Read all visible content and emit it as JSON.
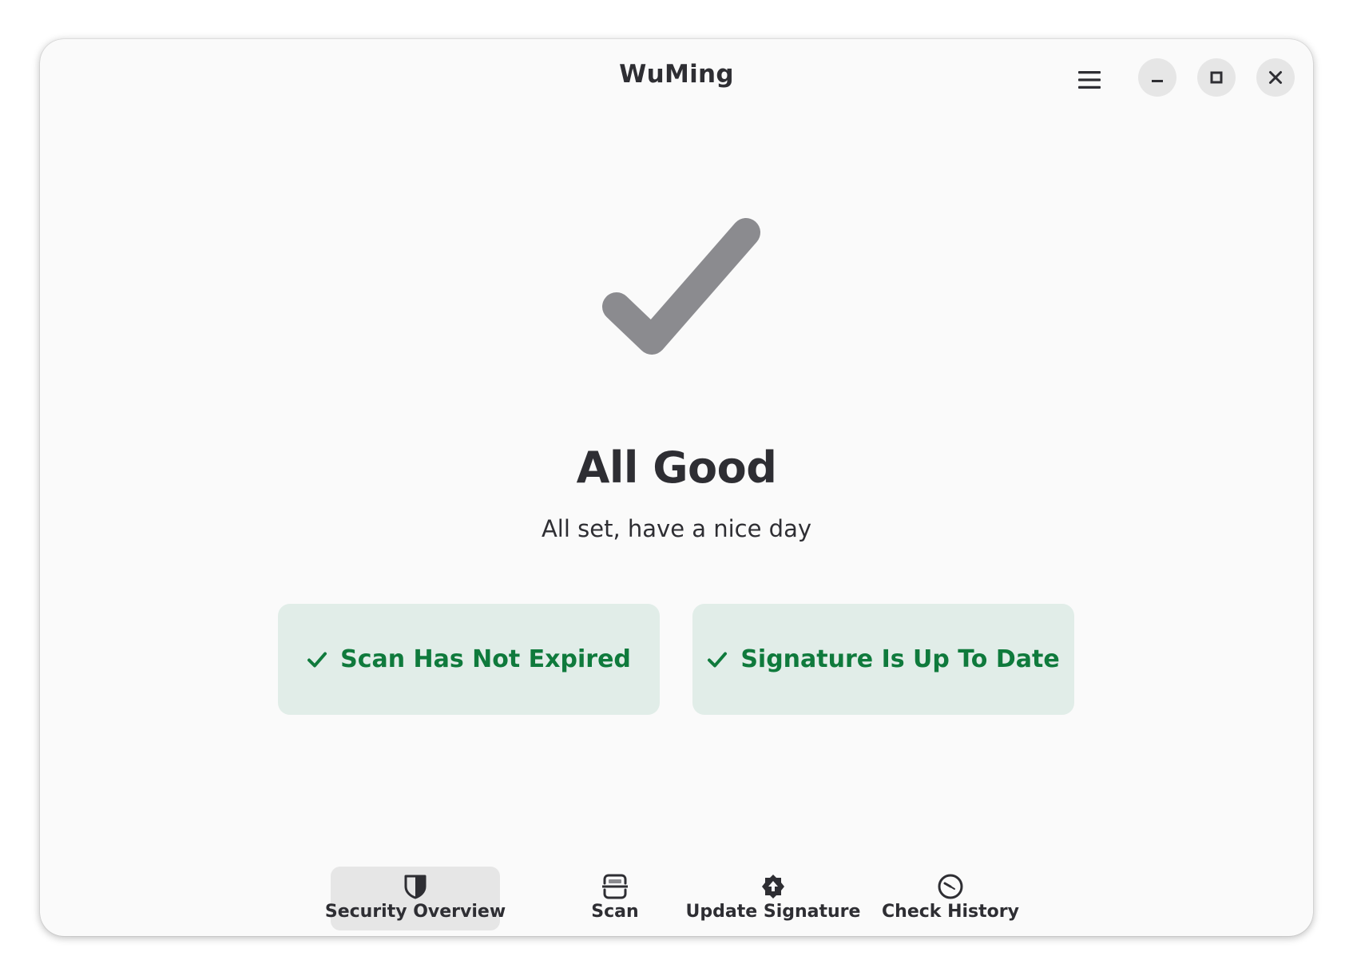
{
  "header": {
    "title": "WuMing",
    "menu_icon": "hamburger-menu-icon",
    "window_controls": [
      "minimize-icon",
      "maximize-icon",
      "close-icon"
    ]
  },
  "status": {
    "icon": "checkmark-icon",
    "title": "All Good",
    "subtitle": "All set, have a nice day"
  },
  "cards": [
    {
      "icon": "check-icon",
      "label": "Scan Has Not Expired"
    },
    {
      "icon": "check-icon",
      "label": "Signature Is Up To Date"
    }
  ],
  "nav": {
    "active": "Security Overview",
    "items": [
      {
        "icon": "shield-icon",
        "label": "Security Overview"
      },
      {
        "icon": "scan-icon",
        "label": "Scan"
      },
      {
        "icon": "update-badge-icon",
        "label": "Update Signature"
      },
      {
        "icon": "clock-icon",
        "label": "Check History"
      }
    ]
  },
  "colors": {
    "window_bg": "#fafafa",
    "text": "#2e2e33",
    "success_text": "#0f7a3c",
    "card_bg": "#e1ede8",
    "status_icon": "#8b8b8f",
    "active_tab_bg": "#e6e6e6"
  }
}
